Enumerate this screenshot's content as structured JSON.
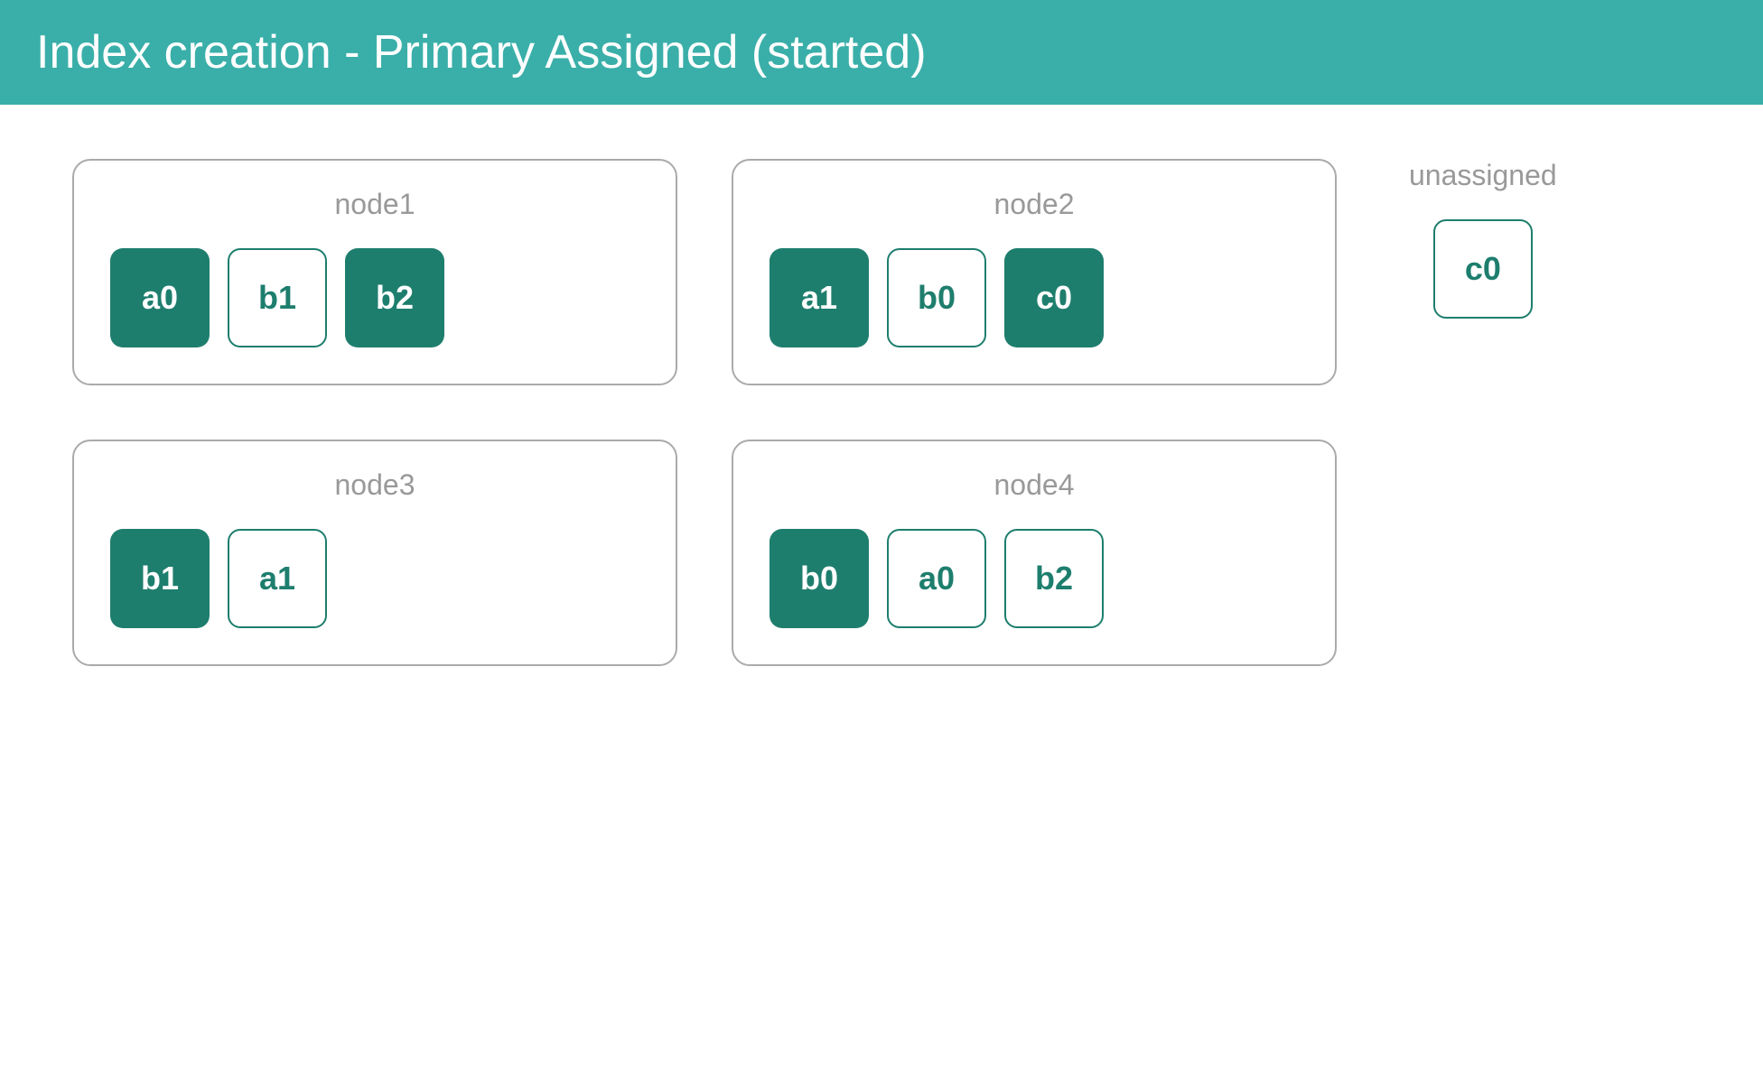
{
  "header": {
    "title": "Index creation - Primary Assigned (started)"
  },
  "nodes": [
    {
      "id": "node1",
      "label": "node1",
      "shards": [
        {
          "name": "a0",
          "type": "primary"
        },
        {
          "name": "b1",
          "type": "replica"
        },
        {
          "name": "b2",
          "type": "primary"
        }
      ]
    },
    {
      "id": "node2",
      "label": "node2",
      "shards": [
        {
          "name": "a1",
          "type": "primary"
        },
        {
          "name": "b0",
          "type": "replica"
        },
        {
          "name": "c0",
          "type": "primary"
        }
      ]
    },
    {
      "id": "node3",
      "label": "node3",
      "shards": [
        {
          "name": "b1",
          "type": "primary"
        },
        {
          "name": "a1",
          "type": "replica"
        }
      ]
    },
    {
      "id": "node4",
      "label": "node4",
      "shards": [
        {
          "name": "b0",
          "type": "primary"
        },
        {
          "name": "a0",
          "type": "replica"
        },
        {
          "name": "b2",
          "type": "replica"
        }
      ]
    }
  ],
  "unassigned": {
    "label": "unassigned",
    "shards": [
      {
        "name": "c0",
        "type": "replica"
      }
    ]
  },
  "colors": {
    "header_bg": "#3aafa9",
    "primary_bg": "#1e7e6e",
    "replica_border": "#1e7e6e"
  }
}
